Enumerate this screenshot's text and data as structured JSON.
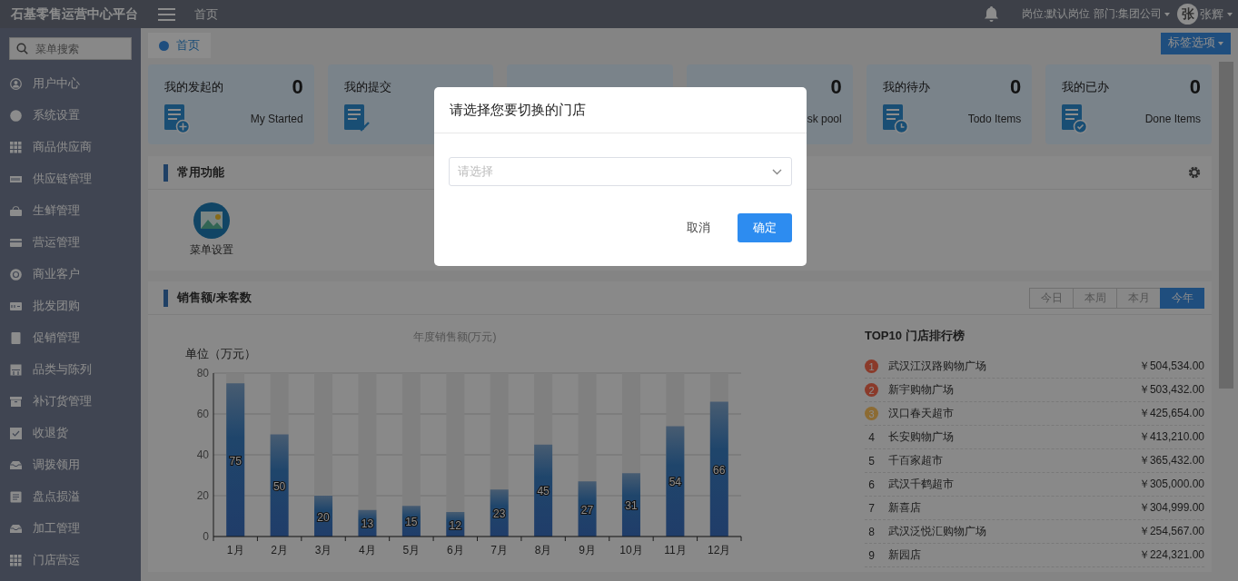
{
  "topbar": {
    "title": "石基零售运营中心平台",
    "home_link": "首页",
    "user_info": "岗位:默认岗位 部门:集团公司",
    "avatar": "张",
    "user_name": "张辉"
  },
  "sidebar": {
    "search_placeholder": "菜单搜索",
    "items": [
      {
        "label": "用户中心"
      },
      {
        "label": "系统设置"
      },
      {
        "label": "商品供应商"
      },
      {
        "label": "供应链管理"
      },
      {
        "label": "生鲜管理"
      },
      {
        "label": "营运管理"
      },
      {
        "label": "商业客户"
      },
      {
        "label": "批发团购"
      },
      {
        "label": "促销管理"
      },
      {
        "label": "品类与陈列"
      },
      {
        "label": "补订货管理"
      },
      {
        "label": "收退货"
      },
      {
        "label": "调拨领用"
      },
      {
        "label": "盘点损溢"
      },
      {
        "label": "加工管理"
      },
      {
        "label": "门店营运"
      }
    ]
  },
  "tabs": [
    {
      "label": "首页",
      "selected": true
    }
  ],
  "tab_options": "标签选项",
  "cards": [
    {
      "kind": "stat",
      "title": "我的发起的",
      "count": "0",
      "subtitle": "My Started"
    },
    {
      "kind": "stat",
      "title": "我的提交"
    },
    {
      "kind": "stat"
    },
    {
      "kind": "stat",
      "count": "0",
      "subtitle": "sk pool"
    },
    {
      "kind": "stat",
      "title": "我的待办",
      "count": "0",
      "subtitle": "Todo Items"
    },
    {
      "kind": "stat",
      "title": "我的已办",
      "count": "0",
      "subtitle": "Done Items"
    }
  ],
  "common_functions": {
    "title": "常用功能",
    "items": [
      {
        "label": "菜单设置"
      }
    ]
  },
  "sales": {
    "title": "销售额/来客数",
    "periods": [
      {
        "label": "今日",
        "selected": false
      },
      {
        "label": "本周",
        "selected": false
      },
      {
        "label": "本月",
        "selected": false
      },
      {
        "label": "今年",
        "selected": true
      }
    ],
    "chart_data": {
      "type": "bar",
      "title": "年度销售额(万元)",
      "ylabel": "单位（万元）",
      "categories": [
        "1月",
        "2月",
        "3月",
        "4月",
        "5月",
        "6月",
        "7月",
        "8月",
        "9月",
        "10月",
        "11月",
        "12月"
      ],
      "values": [
        75,
        50,
        20,
        13,
        15,
        12,
        23,
        45,
        27,
        31,
        54,
        66
      ],
      "ylim": [
        0,
        80
      ],
      "yticks": [
        0,
        20,
        40,
        60,
        80
      ],
      "grid": true,
      "data_labels": true
    },
    "ranking": {
      "title": "TOP10 门店排行榜",
      "rows": [
        {
          "rank": "1",
          "store": "武汉江汉路购物广场",
          "amount": "￥504,534.00",
          "color": "#8a3b2b"
        },
        {
          "rank": "2",
          "store": "新宇购物广场",
          "amount": "￥503,432.00",
          "color": "#8a3b2b"
        },
        {
          "rank": "3",
          "store": "汉口春天超市",
          "amount": "￥425,654.00",
          "color": "#8c6b33"
        },
        {
          "rank": "4",
          "store": "长安购物广场",
          "amount": "￥413,210.00"
        },
        {
          "rank": "5",
          "store": "千百家超市",
          "amount": "￥365,432.00"
        },
        {
          "rank": "6",
          "store": "武汉千鹤超市",
          "amount": "￥305,000.00"
        },
        {
          "rank": "7",
          "store": "新喜店",
          "amount": "￥304,999.00"
        },
        {
          "rank": "8",
          "store": "武汉泛悦汇购物广场",
          "amount": "￥254,567.00"
        },
        {
          "rank": "9",
          "store": "新园店",
          "amount": "￥224,321.00"
        }
      ]
    }
  },
  "dialog": {
    "title": "请选择您要切换的门店",
    "select_placeholder": "请选择",
    "buttons": [
      {
        "label": "取消",
        "kind": "secondary"
      },
      {
        "label": "确定",
        "kind": "primary"
      }
    ]
  }
}
